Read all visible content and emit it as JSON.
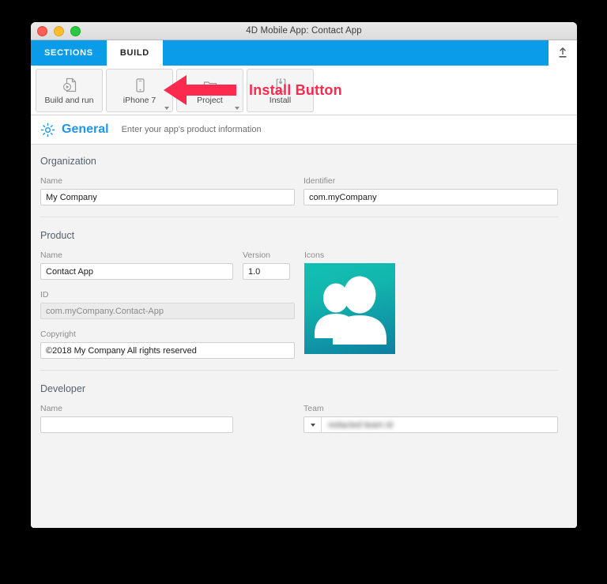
{
  "window": {
    "title": "4D Mobile App: Contact App",
    "traffic_lights": [
      "close",
      "minimize",
      "maximize"
    ]
  },
  "tabs": [
    {
      "label": "SECTIONS",
      "active": false
    },
    {
      "label": "BUILD",
      "active": true
    }
  ],
  "tabbar": {
    "upload_icon": "upload-icon"
  },
  "toolbar": {
    "buttons": [
      {
        "label": "Build and run",
        "icon": "document-play-icon",
        "has_caret": false
      },
      {
        "label": "iPhone 7",
        "icon": "phone-icon",
        "has_caret": true
      },
      {
        "label": "Project",
        "icon": "folder-icon",
        "has_caret": true
      },
      {
        "label": "Install",
        "icon": "phone-download-icon",
        "has_caret": false
      }
    ]
  },
  "annotation": {
    "label": "Install Button",
    "color": "#fb2a4e",
    "arrow_icon": "left-arrow-icon"
  },
  "section": {
    "icon": "gear-icon",
    "title": "General",
    "title_color": "#2196e8",
    "subtitle": "Enter your app's product information"
  },
  "form": {
    "organization": {
      "title": "Organization",
      "name_label": "Name",
      "name_value": "My Company",
      "identifier_label": "Identifier",
      "identifier_value": "com.myCompany"
    },
    "product": {
      "title": "Product",
      "name_label": "Name",
      "name_value": "Contact App",
      "version_label": "Version",
      "version_value": "1.0",
      "icons_label": "Icons",
      "icon_name": "contacts-app-icon",
      "id_label": "ID",
      "id_value": "com.myCompany.Contact-App",
      "copyright_label": "Copyright",
      "copyright_value": "©2018 My Company All rights reserved"
    },
    "developer": {
      "title": "Developer",
      "name_label": "Name",
      "name_value": "",
      "name_placeholder": "",
      "team_label": "Team",
      "team_value": "redacted team id"
    }
  }
}
